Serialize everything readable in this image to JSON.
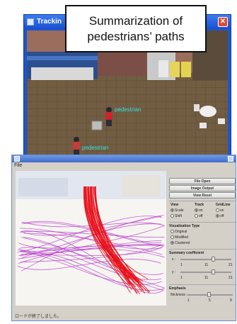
{
  "tracking_window": {
    "title": "Trackin",
    "close_glyph": "✕"
  },
  "callout": {
    "line1": "Summarization of",
    "line2": "pedestrians’ paths"
  },
  "summary_window": {
    "menu": "File",
    "status": "ロードが終了しました。",
    "buttons": {
      "file_open": "File Open",
      "image_output": "Image Output",
      "view_reset": "View Reset"
    },
    "view_group": {
      "view_label": "View",
      "track_label": "Track",
      "gridline_label": "GridLine",
      "scale_option": "Scale",
      "shift_option": "Shift",
      "track_on": "on",
      "track_off": "off",
      "grid_on": "on",
      "grid_off": "off"
    },
    "visualization": {
      "title": "Visualization Type",
      "original": "Original",
      "modified": "Modified",
      "clustered": "Clustered"
    },
    "summary_coefficient": {
      "title": "Summary coefficient",
      "x_label": "x :",
      "y_label": "y :",
      "ticks": [
        "1",
        "11",
        "21"
      ]
    },
    "emphasis": {
      "title": "Emphasis",
      "thickness_label": "thickness :",
      "ticks": [
        "1",
        "5",
        "9"
      ]
    }
  },
  "colors": {
    "titlebar_blue": "#1f56c9",
    "path_red": "#e8101a",
    "path_purple": "#b43cc8",
    "floor_brown": "#6e5a3f",
    "label_cyan": "#35e0e0"
  },
  "tracked_labels": [
    "pedestrian",
    "pedestrian"
  ]
}
